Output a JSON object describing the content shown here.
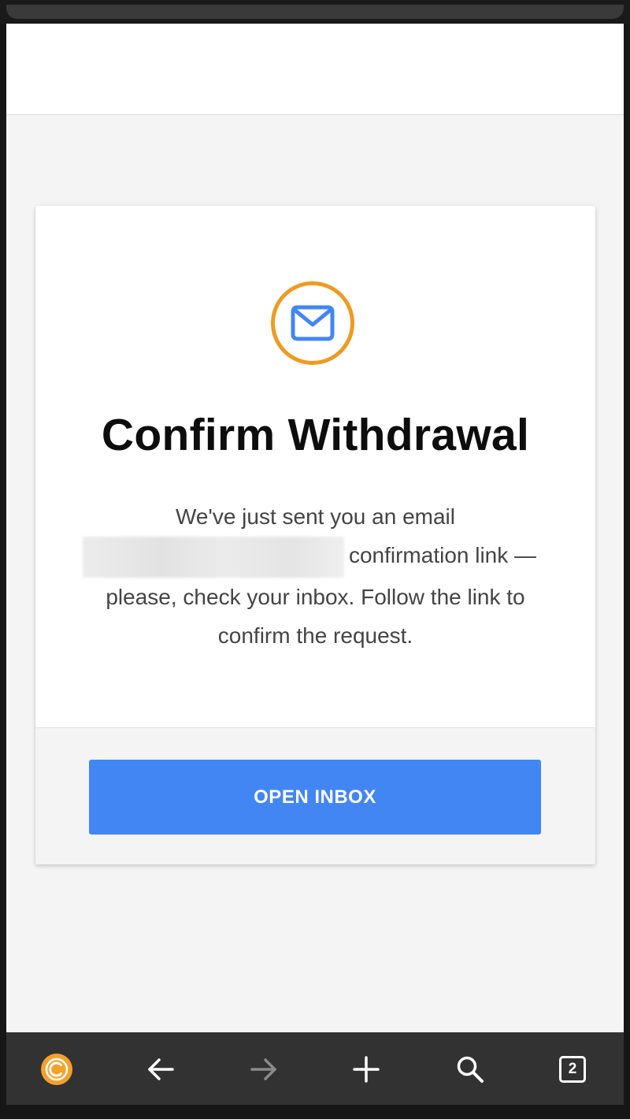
{
  "page": {
    "title": "Confirm Withdrawal",
    "message_before": "We've just sent you an email",
    "message_after": "confirmation link — please, check your inbox. Follow the link to confirm the request.",
    "primary_button_label": "OPEN INBOX"
  },
  "bottom_nav": {
    "tab_count": "2",
    "items": [
      {
        "name": "browser-logo",
        "icon": "c-coin-icon"
      },
      {
        "name": "back",
        "icon": "arrow-left-icon"
      },
      {
        "name": "forward",
        "icon": "arrow-right-icon",
        "disabled": true
      },
      {
        "name": "new-tab",
        "icon": "plus-icon"
      },
      {
        "name": "search",
        "icon": "search-icon"
      },
      {
        "name": "tabs",
        "icon": "tabs-icon"
      }
    ]
  },
  "colors": {
    "accent_ring": "#f09a22",
    "envelope": "#4286f4",
    "button": "#4286f4",
    "nav_bar": "#323232"
  }
}
